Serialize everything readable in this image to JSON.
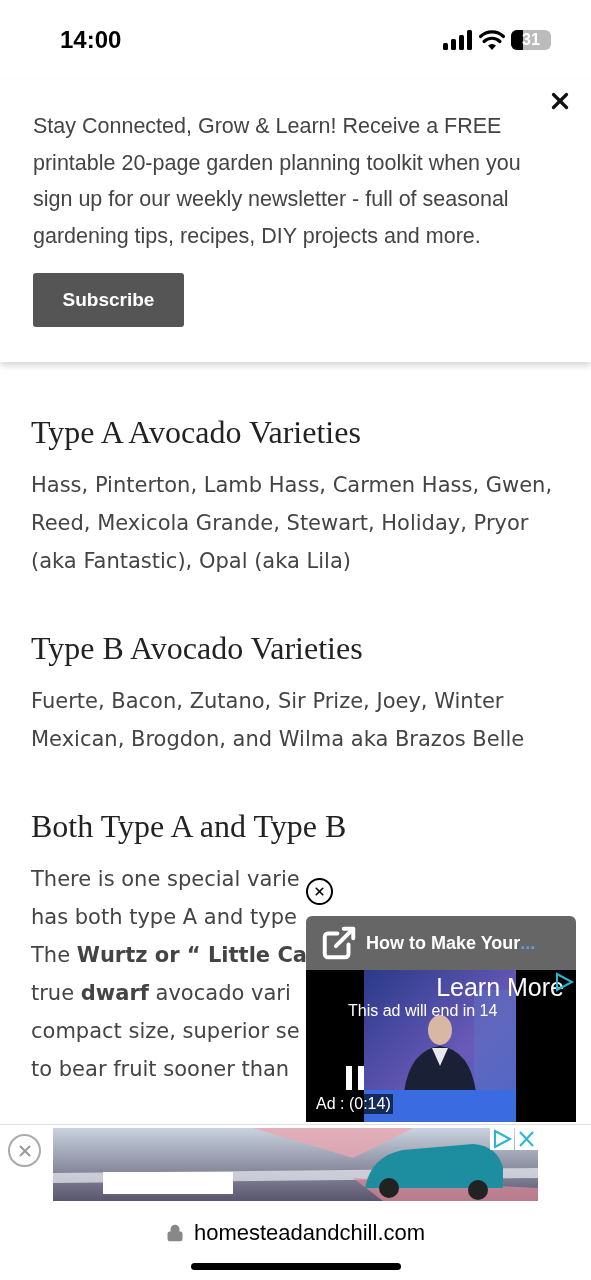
{
  "status_bar": {
    "time": "14:00",
    "battery": "31"
  },
  "newsletter": {
    "message": "Stay Connected, Grow & Learn! Receive a FREE printable 20-page garden planning toolkit when you sign up for our weekly newsletter - full of seasonal gardening tips, recipes, DIY projects and more.",
    "button": "Subscribe"
  },
  "sections": [
    {
      "heading": "Type A Avocado Varieties",
      "text": "Hass, Pinterton, Lamb Hass, Carmen Hass, Gwen, Reed, Mexicola Grande, Stewart, Holiday, Pryor (aka Fantastic), Opal (aka Lila)"
    },
    {
      "heading": "Type B Avocado Varieties",
      "text": "Fuerte, Bacon, Zutano, Sir Prize, Joey, Winter Mexican, Brogdon, and Wilma aka Brazos Belle"
    },
    {
      "heading": "Both Type A and Type B",
      "lines": [
        "There is one special varie",
        "has both type A and type",
        "The **Wurtz or “ Little Ca**",
        "true **dwarf** avocado vari",
        "compact size, superior se",
        "to bear fruit sooner than"
      ]
    }
  ],
  "video_ad": {
    "title": "How to Make Your",
    "ellipsis": "...",
    "learn_more": "Learn More",
    "countdown": "This ad will end in 14",
    "ad_label": "Ad : (0:14)"
  },
  "address_bar": {
    "url": "homesteadandchill.com"
  }
}
